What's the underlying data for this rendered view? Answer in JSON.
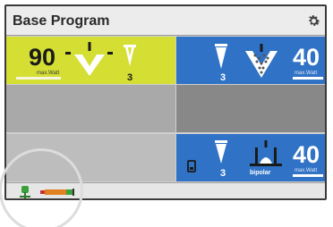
{
  "header": {
    "title": "Base Program",
    "settings_icon": "gear-icon"
  },
  "cut": {
    "color": "#d4de33",
    "value": "90",
    "unit_label": "max.Watt",
    "mode_number": "3",
    "level_fraction": 0.5,
    "icons": [
      "cut-blade-icon",
      "cut-mode-v-icon"
    ]
  },
  "coag": {
    "color": "#2f72c6",
    "value": "40",
    "unit_label": "max.Watt",
    "mode_number": "3",
    "level_fraction": 0.6,
    "icons": [
      "coag-mode-v-icon",
      "coag-spray-icon"
    ]
  },
  "bipolar": {
    "color": "#2f72c6",
    "value": "40",
    "unit_label": "max.Watt",
    "mode_number": "3",
    "mode_label": "bipolar",
    "level_fraction": 0.6,
    "icons": [
      "footswitch-icon",
      "bipolar-mode-v-icon",
      "bipolar-forceps-icon"
    ]
  },
  "status": {
    "icons": [
      "electrode-icon",
      "neutral-electrode-indicator"
    ]
  }
}
